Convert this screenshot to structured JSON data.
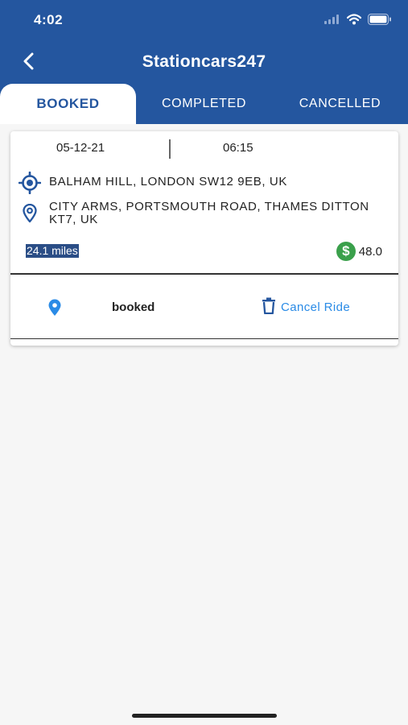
{
  "status_bar": {
    "time": "4:02"
  },
  "nav": {
    "title": "Stationcars247"
  },
  "tabs": [
    {
      "label": "BOOKED",
      "active": true
    },
    {
      "label": "COMPLETED",
      "active": false
    },
    {
      "label": "CANCELLED",
      "active": false
    }
  ],
  "ride": {
    "date": "05-12-21",
    "time": "06:15",
    "pickup": "BALHAM HILL, LONDON SW12 9EB, UK",
    "dropoff": "CITY ARMS, PORTSMOUTH ROAD, THAMES DITTON KT7, UK",
    "distance": "24.1 miles",
    "fare": "48.0",
    "status": "booked",
    "cancel_label": "Cancel Ride"
  },
  "colors": {
    "header": "#24569f",
    "accent": "#2a8be6",
    "fare_icon": "#3aa04b"
  },
  "icons": {
    "back": "chevron-left-icon",
    "pickup": "crosshair-icon",
    "dropoff": "map-pin-icon",
    "fare": "dollar-icon",
    "status": "location-pin-icon",
    "cancel": "trash-icon"
  }
}
